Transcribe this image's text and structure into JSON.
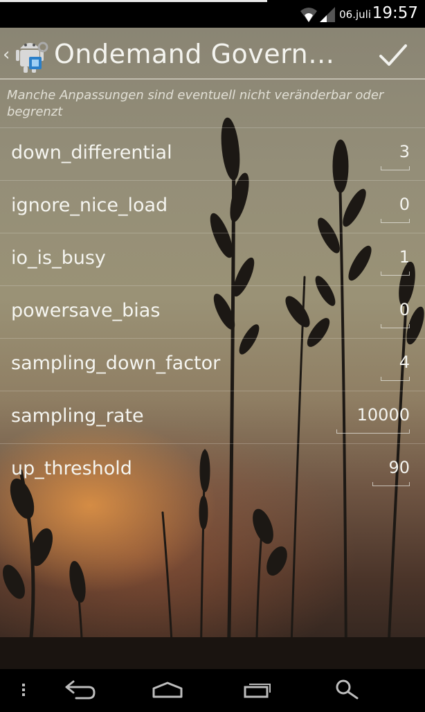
{
  "status_bar": {
    "date": "06.juli",
    "time": "19:57",
    "icons": [
      "wifi-icon",
      "signal-icon"
    ]
  },
  "action_bar": {
    "title": "Ondemand Govern…",
    "back_icon": "chevron-left-icon",
    "app_icon": "android-robot-icon",
    "confirm_icon": "checkmark-icon"
  },
  "notice": "Manche Anpassungen sind eventuell nicht veränderbar oder begrenzt",
  "settings": [
    {
      "label": "down_differential",
      "value": "3"
    },
    {
      "label": "ignore_nice_load",
      "value": "0"
    },
    {
      "label": "io_is_busy",
      "value": "1"
    },
    {
      "label": "powersave_bias",
      "value": "0"
    },
    {
      "label": "sampling_down_factor",
      "value": "4"
    },
    {
      "label": "sampling_rate",
      "value": "10000"
    },
    {
      "label": "up_threshold",
      "value": "90"
    }
  ],
  "nav_bar": {
    "icons": [
      "menu-dots-icon",
      "back-icon",
      "home-icon",
      "recent-apps-icon",
      "search-icon"
    ]
  }
}
